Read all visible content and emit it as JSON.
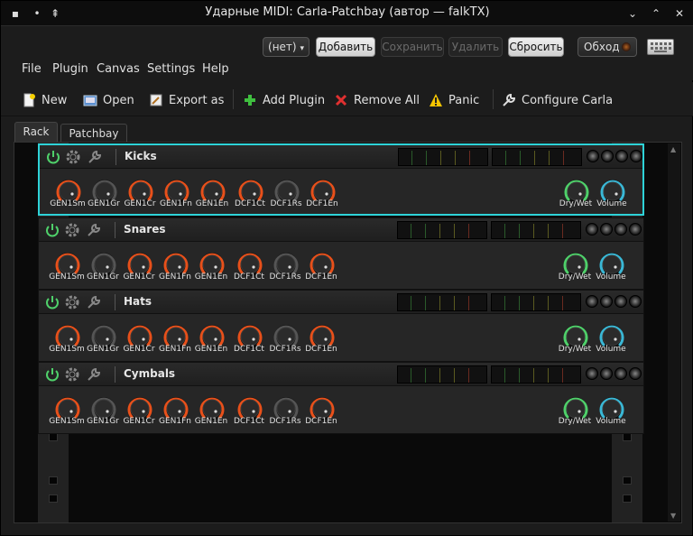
{
  "window": {
    "title": "Ударные MIDI: Carla-Patchbay (автор — falkTX)"
  },
  "topbar": {
    "preset_value": "(нет)",
    "add_label": "Добавить",
    "save_label": "Сохранить",
    "delete_label": "Удалить",
    "reset_label": "Сбросить",
    "bypass_label": "Обход"
  },
  "menu": {
    "file": "File",
    "plugin": "Plugin",
    "canvas": "Canvas",
    "settings": "Settings",
    "help": "Help"
  },
  "toolbar": {
    "new": "New",
    "open": "Open",
    "export": "Export as",
    "add_plugin": "Add Plugin",
    "remove_all": "Remove All",
    "panic": "Panic",
    "configure": "Configure Carla"
  },
  "tabs": {
    "rack": "Rack",
    "patchbay": "Patchbay"
  },
  "knob_labels": [
    "GEN1Sm",
    "GEN1Gr",
    "GEN1Cr",
    "GEN1Fn",
    "GEN1En",
    "DCF1Ct",
    "DCF1Rs",
    "DCF1En"
  ],
  "knob_types": [
    "red",
    "gray",
    "red",
    "red",
    "red",
    "red",
    "gray",
    "red"
  ],
  "mix_labels": [
    "Dry/Wet",
    "Volume"
  ],
  "plugins": [
    {
      "name": "Kicks",
      "selected": true
    },
    {
      "name": "Snares",
      "selected": false
    },
    {
      "name": "Hats",
      "selected": false
    },
    {
      "name": "Cymbals",
      "selected": false
    }
  ],
  "colors": {
    "selected_border": "#2ed3d8",
    "knob_red": "#e8501a",
    "knob_green": "#4fd06a",
    "knob_cyan": "#3ab8d6"
  }
}
